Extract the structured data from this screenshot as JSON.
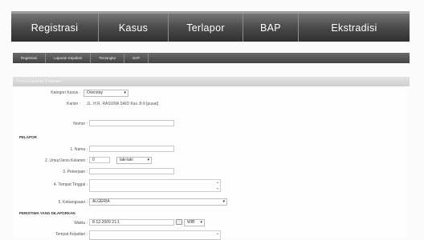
{
  "nav": {
    "tabs": [
      "Registrasi",
      "Kasus",
      "Terlapor",
      "BAP",
      "Ekstradisi"
    ]
  },
  "subnav": {
    "tabs": [
      "Registrasi",
      "Laporan Kejadian",
      "Tersangka",
      "BAP"
    ]
  },
  "panel": {
    "title": "Form Laporan Kejadian"
  },
  "form": {
    "kategori_kasus_label": "Kategori Kasus :",
    "kategori_kasus_value": "Overstay",
    "kanim_label": "Kanim :",
    "kanim_value": "JL. H.R. RASUNA SAID Kav. 8-9 [pusat]",
    "nomor_label": "Nomor :",
    "pelapor_section": "PELAPOR",
    "nama_label": "1. Nama :",
    "umur_label": "2. Umur/Jenis Kelamin :",
    "umur_value": "0",
    "jk_value": "laki-laki",
    "pekerjaan_label": "3. Pekerjaan :",
    "tempat_tinggal_label": "4. Tempat Tinggal :",
    "kebangsaan_label": "5. Kebangsaan :",
    "kebangsaan_value": "ALGERIA",
    "peristiwa_section": "PERISTIWA YANG DILAPORKAN",
    "waktu_label": "Waktu :",
    "waktu_value": "8-12-2009 21:1",
    "zona_value": "WIB",
    "tempat_kejadian_label": "Tempat Kejadian :"
  },
  "colors": {
    "nav_bg": "#3a3a3a",
    "subnav_bg": "#555555",
    "panel_head": "#d8d8d8"
  }
}
